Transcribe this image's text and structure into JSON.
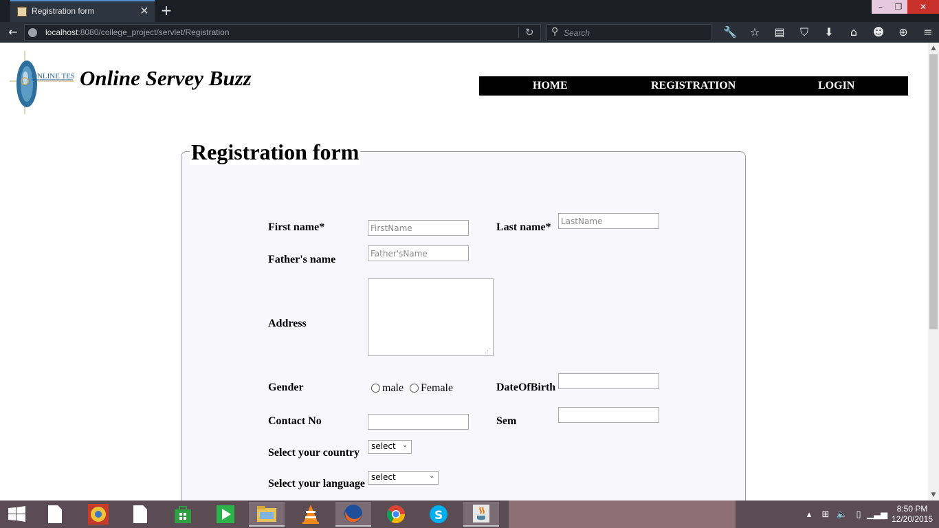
{
  "browser": {
    "tab_title": "Registration form",
    "url_host": "localhost",
    "url_rest": ":8080/college_project/servlet/Registration",
    "search_placeholder": "Search",
    "window_controls": {
      "minimize": "–",
      "restore": "❐",
      "close": "✕"
    }
  },
  "header": {
    "logo_text": "ONLINE TEST",
    "site_title": "Online Servey Buzz"
  },
  "menu": {
    "items": [
      {
        "label": "HOME"
      },
      {
        "label": "REGISTRATION"
      },
      {
        "label": "LOGIN"
      }
    ]
  },
  "form": {
    "legend": "Registration form",
    "first_name_label": "First name*",
    "first_name_placeholder": "FirstName",
    "last_name_label": "Last name*",
    "last_name_placeholder": "LastName",
    "father_name_label": "Father's name",
    "father_name_placeholder": "Father'sName",
    "address_label": "Address",
    "gender_label": "Gender",
    "gender_options": [
      "male",
      "Female"
    ],
    "dob_label": "DateOfBirth",
    "contact_label": "Contact No",
    "sem_label": "Sem",
    "country_label": "Select your country",
    "country_selected": "select",
    "language_label": "Select your language",
    "language_selected": "select"
  },
  "taskbar": {
    "time": "8:50 PM",
    "date": "12/20/2015"
  }
}
